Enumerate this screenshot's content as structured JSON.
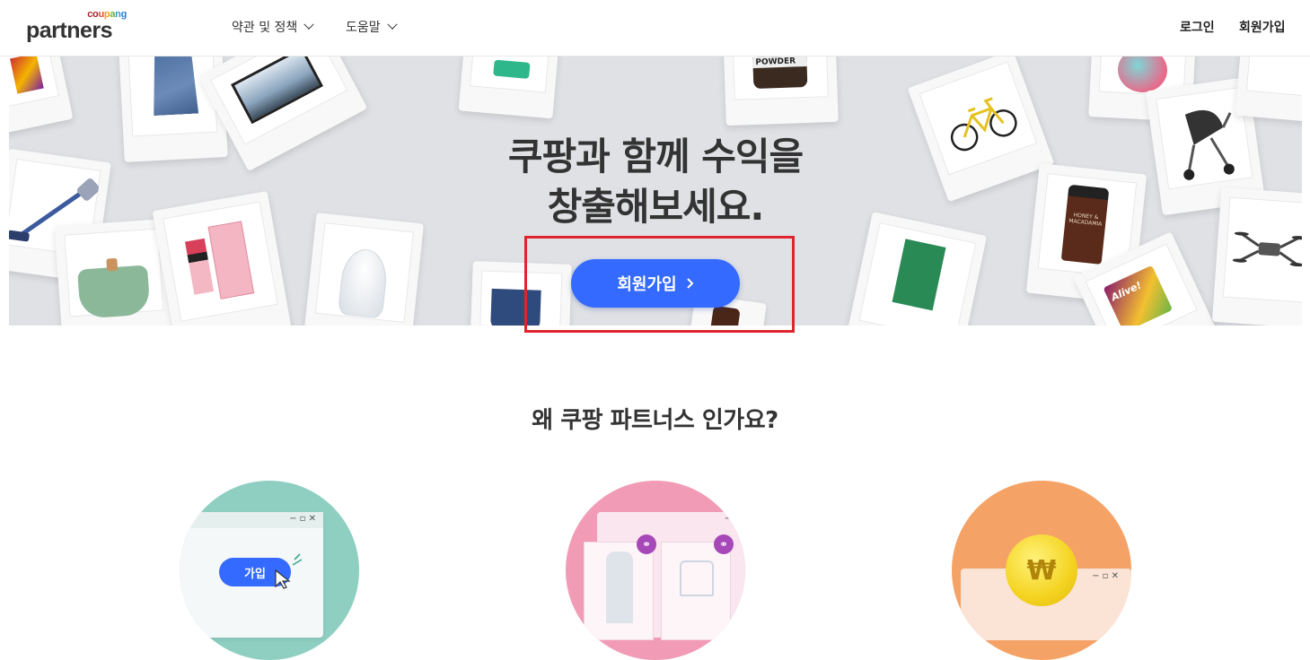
{
  "header": {
    "logo_small": "coupang",
    "logo_large": "partners",
    "nav": [
      {
        "label": "약관 및 정책"
      },
      {
        "label": "도움말"
      }
    ],
    "login_label": "로그인",
    "signup_label": "회원가입"
  },
  "hero": {
    "title_line1": "쿠팡과 함께 수익을",
    "title_line2": "창출해보세요.",
    "cta_label": "회원가입",
    "product_labels": {
      "powder": "POWDER",
      "shampoo": "HONEY & MACADAMIA",
      "vitamin": "Alive!"
    }
  },
  "why": {
    "title": "왜 쿠팡 파트너스 인가요?",
    "features": [
      {
        "badge_label": "가입",
        "color": "#8ecfc2"
      },
      {
        "color": "#f19bb7"
      },
      {
        "coin_label": "₩",
        "color": "#f5a266"
      }
    ]
  },
  "colors": {
    "primary": "#346aff",
    "highlight": "#e0242e",
    "hero_bg": "#dfe1e5"
  }
}
